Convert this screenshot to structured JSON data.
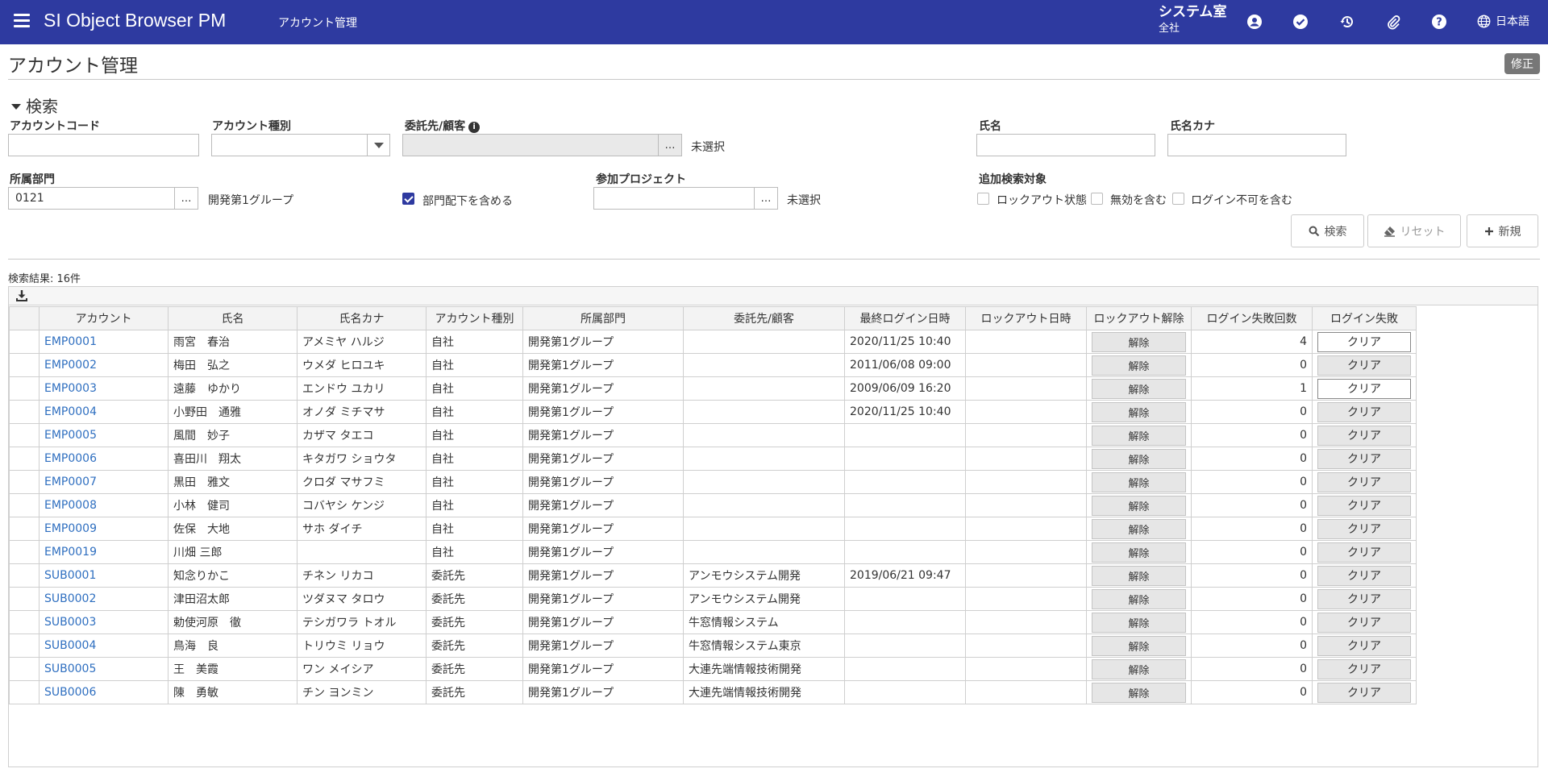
{
  "header": {
    "app_title": "SI Object Browser PM",
    "page": "アカウント管理",
    "org_name": "システム室",
    "org_sub": "全社",
    "language": "日本語"
  },
  "page": {
    "title": "アカウント管理",
    "edit_label": "修正"
  },
  "search": {
    "heading": "検索",
    "account_code_label": "アカウントコード",
    "account_code_value": "",
    "account_type_label": "アカウント種別",
    "account_type_value": "",
    "client_label": "委託先/顧客",
    "client_status": "未選択",
    "name_label": "氏名",
    "kana_label": "氏名カナ",
    "dept_label": "所属部門",
    "dept_code": "0121",
    "dept_name": "開発第1グループ",
    "include_sub_label": "部門配下を含める",
    "project_label": "参加プロジェクト",
    "project_status": "未選択",
    "extra_label": "追加検索対象",
    "extra_lockout": "ロックアウト状態",
    "extra_disabled": "無効を含む",
    "extra_nologin": "ログイン不可を含む",
    "search_btn": "検索",
    "reset_btn": "リセット",
    "new_btn": "新規"
  },
  "results": {
    "count_text": "検索結果: 16件",
    "columns": [
      "アカウント",
      "氏名",
      "氏名カナ",
      "アカウント種別",
      "所属部門",
      "委託先/顧客",
      "最終ログイン日時",
      "ロックアウト日時",
      "ロックアウト解除",
      "ログイン失敗回数",
      "ログイン失敗"
    ],
    "unlock_label": "解除",
    "clear_label": "クリア",
    "rows": [
      {
        "account": "EMP0001",
        "name": "雨宮　春治",
        "kana": "アメミヤ ハルジ",
        "type": "自社",
        "dept": "開発第1グループ",
        "client": "",
        "last_login": "2020/11/25 10:40",
        "lockout": "",
        "fails": "4",
        "active": true
      },
      {
        "account": "EMP0002",
        "name": "梅田　弘之",
        "kana": "ウメダ ヒロユキ",
        "type": "自社",
        "dept": "開発第1グループ",
        "client": "",
        "last_login": "2011/06/08 09:00",
        "lockout": "",
        "fails": "0",
        "active": false
      },
      {
        "account": "EMP0003",
        "name": "遠藤　ゆかり",
        "kana": "エンドウ ユカリ",
        "type": "自社",
        "dept": "開発第1グループ",
        "client": "",
        "last_login": "2009/06/09 16:20",
        "lockout": "",
        "fails": "1",
        "active": true
      },
      {
        "account": "EMP0004",
        "name": "小野田　通雅",
        "kana": "オノダ ミチマサ",
        "type": "自社",
        "dept": "開発第1グループ",
        "client": "",
        "last_login": "2020/11/25 10:40",
        "lockout": "",
        "fails": "0",
        "active": false
      },
      {
        "account": "EMP0005",
        "name": "風間　妙子",
        "kana": "カザマ タエコ",
        "type": "自社",
        "dept": "開発第1グループ",
        "client": "",
        "last_login": "",
        "lockout": "",
        "fails": "0",
        "active": false
      },
      {
        "account": "EMP0006",
        "name": "喜田川　翔太",
        "kana": "キタガワ ショウタ",
        "type": "自社",
        "dept": "開発第1グループ",
        "client": "",
        "last_login": "",
        "lockout": "",
        "fails": "0",
        "active": false
      },
      {
        "account": "EMP0007",
        "name": "黒田　雅文",
        "kana": "クロダ マサフミ",
        "type": "自社",
        "dept": "開発第1グループ",
        "client": "",
        "last_login": "",
        "lockout": "",
        "fails": "0",
        "active": false
      },
      {
        "account": "EMP0008",
        "name": "小林　健司",
        "kana": "コバヤシ ケンジ",
        "type": "自社",
        "dept": "開発第1グループ",
        "client": "",
        "last_login": "",
        "lockout": "",
        "fails": "0",
        "active": false
      },
      {
        "account": "EMP0009",
        "name": "佐保　大地",
        "kana": "サホ ダイチ",
        "type": "自社",
        "dept": "開発第1グループ",
        "client": "",
        "last_login": "",
        "lockout": "",
        "fails": "0",
        "active": false
      },
      {
        "account": "EMP0019",
        "name": "川畑 三郎",
        "kana": "",
        "type": "自社",
        "dept": "開発第1グループ",
        "client": "",
        "last_login": "",
        "lockout": "",
        "fails": "0",
        "active": false
      },
      {
        "account": "SUB0001",
        "name": "知念りかこ",
        "kana": "チネン リカコ",
        "type": "委託先",
        "dept": "開発第1グループ",
        "client": "アンモウシステム開発",
        "last_login": "2019/06/21 09:47",
        "lockout": "",
        "fails": "0",
        "active": false
      },
      {
        "account": "SUB0002",
        "name": "津田沼太郎",
        "kana": "ツダヌマ タロウ",
        "type": "委託先",
        "dept": "開発第1グループ",
        "client": "アンモウシステム開発",
        "last_login": "",
        "lockout": "",
        "fails": "0",
        "active": false
      },
      {
        "account": "SUB0003",
        "name": "勅使河原　徹",
        "kana": "テシガワラ トオル",
        "type": "委託先",
        "dept": "開発第1グループ",
        "client": "牛窓情報システム",
        "last_login": "",
        "lockout": "",
        "fails": "0",
        "active": false
      },
      {
        "account": "SUB0004",
        "name": "鳥海　良",
        "kana": "トリウミ リョウ",
        "type": "委託先",
        "dept": "開発第1グループ",
        "client": "牛窓情報システム東京",
        "last_login": "",
        "lockout": "",
        "fails": "0",
        "active": false
      },
      {
        "account": "SUB0005",
        "name": "王　美霞",
        "kana": "ワン メイシア",
        "type": "委託先",
        "dept": "開発第1グループ",
        "client": "大連先端情報技術開発",
        "last_login": "",
        "lockout": "",
        "fails": "0",
        "active": false
      },
      {
        "account": "SUB0006",
        "name": "陳　勇敏",
        "kana": "チン ヨンミン",
        "type": "委託先",
        "dept": "開発第1グループ",
        "client": "大連先端情報技術開発",
        "last_login": "",
        "lockout": "",
        "fails": "0",
        "active": false
      }
    ]
  },
  "icons": {
    "menu": "hamburger-icon",
    "user": "user-circle-icon",
    "check": "check-circle-icon",
    "history": "history-icon",
    "attach": "paperclip-icon",
    "help": "help-icon",
    "globe": "globe-icon",
    "download": "download-icon"
  },
  "colors": {
    "header_bg": "#2e3aa0",
    "link": "#2f6fc0"
  }
}
